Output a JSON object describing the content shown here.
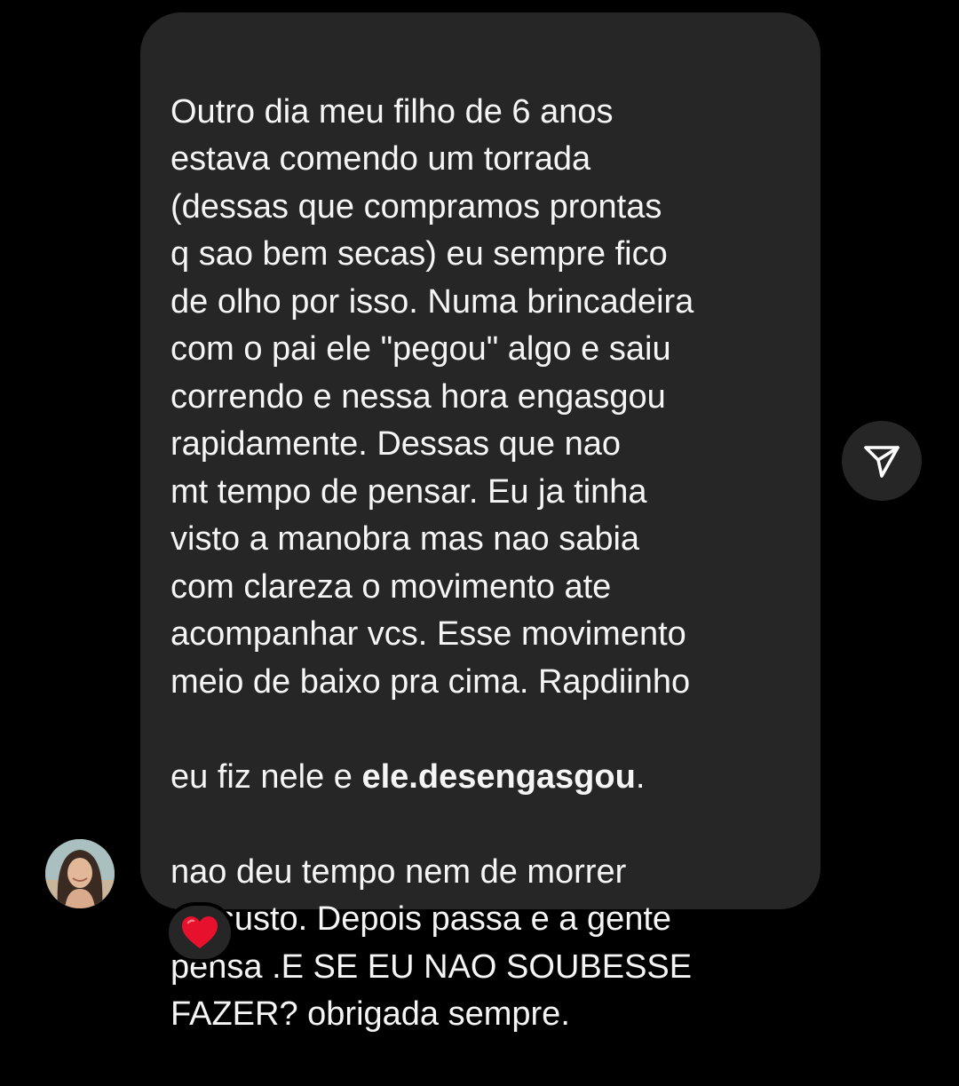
{
  "message": {
    "lines_before_bold": [
      "Outro dia meu filho de 6 anos",
      "estava comendo um torrada",
      "(dessas que compramos prontas",
      "q sao bem secas) eu sempre fico",
      "de olho por isso. Numa brincadeira",
      "com o pai ele \"pegou\" algo e saiu",
      "correndo e nessa hora engasgou",
      "rapidamente. Dessas que nao",
      "mt tempo de pensar. Eu ja tinha",
      "visto a manobra mas nao sabia",
      "com clareza o movimento ate",
      "acompanhar vcs. Esse movimento",
      "meio de baixo pra cima. Rapdiinho"
    ],
    "bold_line_prefix": "eu fiz nele e ",
    "bold_text": "ele.desengasgou",
    "bold_line_suffix": ".",
    "lines_after_bold": [
      "nao deu tempo nem de morrer",
      "de susto. Depois passa e a gente",
      "pensa .E SE EU NAO SOUBESSE",
      "FAZER? obrigada sempre."
    ]
  },
  "icons": {
    "share": "paper-plane-icon",
    "reaction": "red-heart-icon",
    "avatar": "user-avatar"
  },
  "colors": {
    "background": "#000000",
    "bubble": "#262626",
    "text": "#f5f5f5",
    "heart": "#e8112d"
  }
}
